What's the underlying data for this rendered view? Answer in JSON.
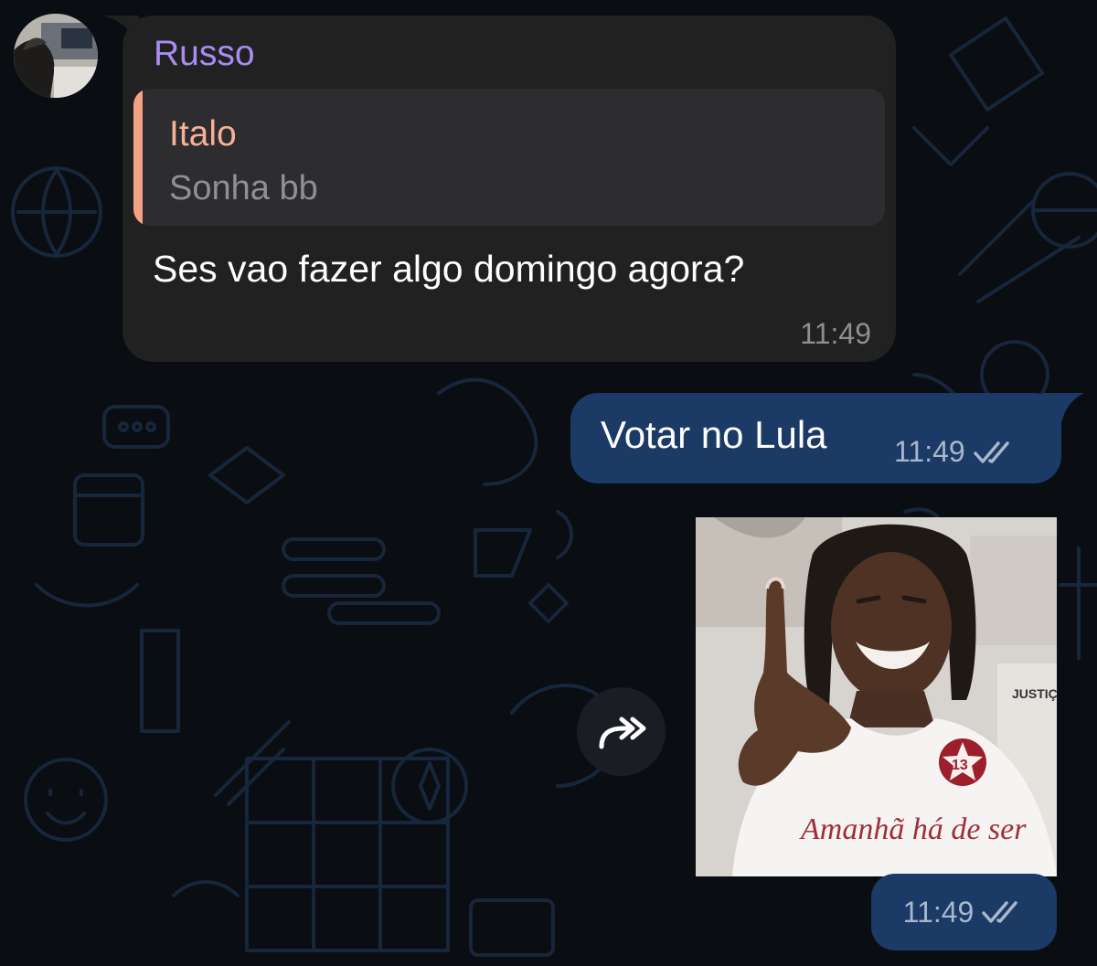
{
  "incoming": {
    "sender": "Russo",
    "reply": {
      "name": "Italo",
      "text": "Sonha bb"
    },
    "text": "Ses vao fazer algo domingo agora?",
    "time": "11:49"
  },
  "outgoing_text": {
    "text": "Votar no Lula",
    "time": "11:49",
    "status": "read"
  },
  "outgoing_media": {
    "time": "11:49",
    "status": "read",
    "shirt_text": "Amanhã há de ser",
    "badge_number": "13",
    "sign_text": "JUSTIÇA"
  },
  "icons": {
    "forward": "forward-icon",
    "read": "double-check-icon"
  },
  "colors": {
    "background": "#0a0d12",
    "incoming_bubble": "#212121",
    "outgoing_bubble": "#1b3a65",
    "sender_name": "#a98cf2",
    "reply_accent": "#f4a283"
  }
}
